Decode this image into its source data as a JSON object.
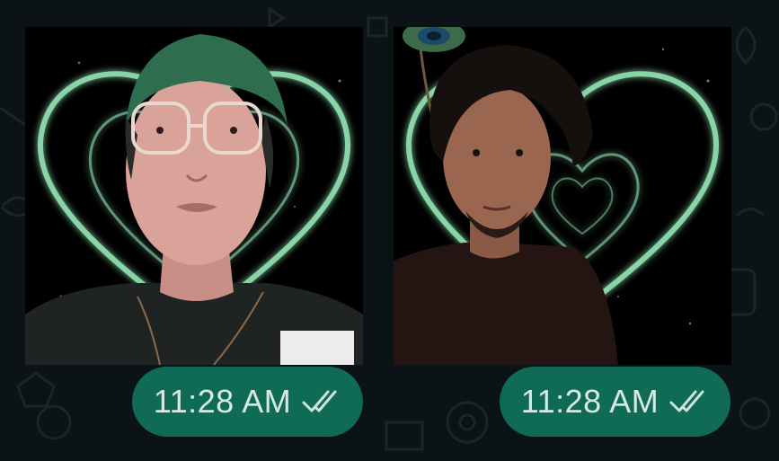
{
  "chat": {
    "messages": [
      {
        "type": "sticker",
        "subject": "person-with-glasses-heart-background",
        "time": "11:28 AM",
        "status": "read"
      },
      {
        "type": "sticker",
        "subject": "man-with-peacock-feather-heart-background",
        "time": "11:28 AM",
        "status": "read"
      }
    ]
  },
  "colors": {
    "background": "#0c1317",
    "timestamp_pill": "#0f6b56",
    "timestamp_text": "#d6e9e3",
    "heart_glow": "#8fe0b0"
  },
  "icons": {
    "status": "double-check-icon"
  }
}
